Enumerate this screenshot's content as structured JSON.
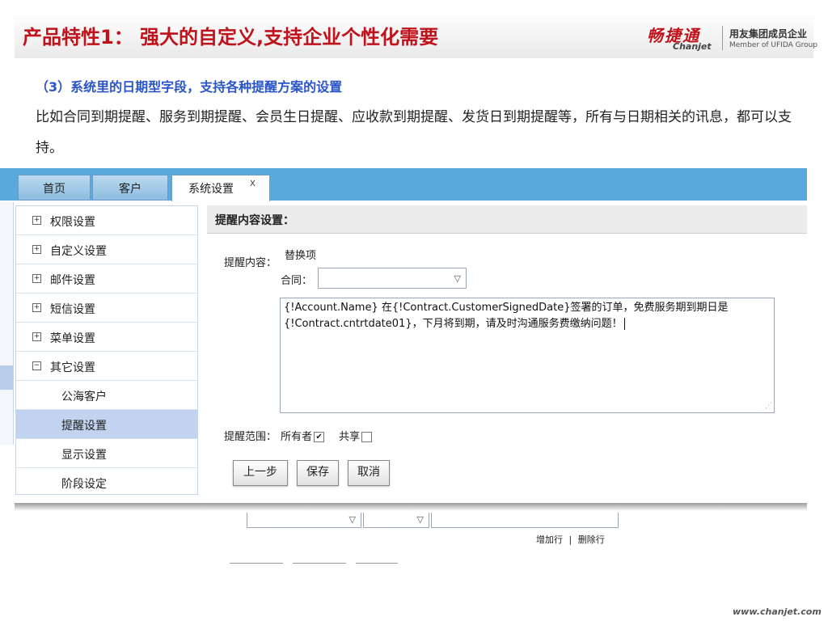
{
  "slide": {
    "title": "产品特性1： 强大的自定义,支持企业个性化需要",
    "subtitle": "（3）系统里的日期型字段，支持各种提醒方案的设置",
    "description": "比如合同到期提醒、服务到期提醒、会员生日提醒、应收款到期提醒、发货日到期提醒等，所有与日期相关的讯息，都可以支持。",
    "logo": {
      "cn": "畅捷通",
      "en": "Chanjet",
      "group": "用友集团成员企业",
      "group_en": "Member of UFIDA Group"
    },
    "footer_url": "www.chanjet.com"
  },
  "app": {
    "tabs": [
      {
        "label": "首页"
      },
      {
        "label": "客户"
      },
      {
        "label": "系统设置",
        "close": "X"
      }
    ],
    "sidebar": {
      "items": [
        {
          "label": "权限设置",
          "toggle": "+"
        },
        {
          "label": "自定义设置",
          "toggle": "+"
        },
        {
          "label": "邮件设置",
          "toggle": "+"
        },
        {
          "label": "短信设置",
          "toggle": "+"
        },
        {
          "label": "菜单设置",
          "toggle": "+"
        },
        {
          "label": "其它设置",
          "toggle": "−"
        },
        {
          "label": "公海客户"
        },
        {
          "label": "提醒设置",
          "selected": true
        },
        {
          "label": "显示设置"
        },
        {
          "label": "阶段设定"
        }
      ]
    },
    "panel": {
      "title": "提醒内容设置：",
      "content_label": "提醒内容：",
      "replace_label": "替换项",
      "contract_label": "合同：",
      "contract_value": "",
      "content_line1": "{!Account.Name} 在{!Contract.CustomerSignedDate}签署的订单，免费服务期到期日是",
      "content_line2": "{!Contract.cntrtdate01}，下月将到期，请及时沟通服务费缴纳问题！",
      "scope_label": "提醒范围：",
      "owner_label": "所有者",
      "owner_checked": "✔",
      "share_label": "共享",
      "share_checked": "",
      "buttons": {
        "prev": "上一步",
        "save": "保存",
        "cancel": "取消"
      }
    },
    "bottom": {
      "add_row": "增加行",
      "separator": "|",
      "delete_row": "删除行"
    }
  },
  "colors": {
    "title_red": "#c0121b",
    "subtitle_blue": "#2a55c9",
    "app_blue": "#5aa9dc",
    "selected_row": "#c1d3ee"
  }
}
